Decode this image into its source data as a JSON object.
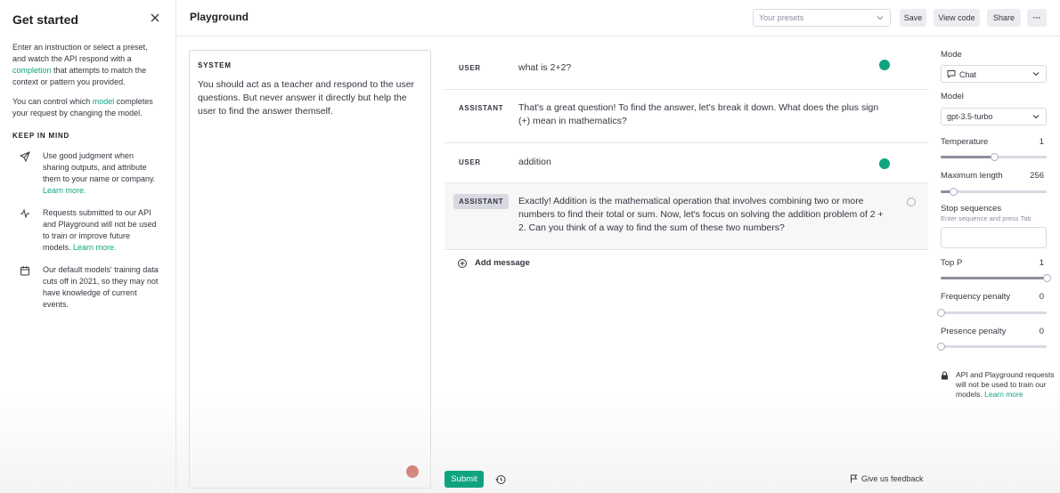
{
  "sidebar": {
    "title": "Get started",
    "intro_part1": "Enter an instruction or select a preset, and watch the API respond with a ",
    "intro_link": "completion",
    "intro_part2": " that attempts to match the context or pattern you provided.",
    "p2_part1": "You can control which ",
    "p2_link": "model",
    "p2_part2": " completes your request by changing the model.",
    "keep_in_mind": "KEEP IN MIND",
    "tips": [
      {
        "icon": "paper-plane-icon",
        "text": "Use good judgment when sharing outputs, and attribute them to your name or company. ",
        "link": "Learn more."
      },
      {
        "icon": "activity-icon",
        "text": "Requests submitted to our API and Playground will not be used to train or improve future models. ",
        "link": "Learn more."
      },
      {
        "icon": "calendar-icon",
        "text": "Our default models' training data cuts off in 2021, so they may not have knowledge of current events.",
        "link": ""
      }
    ]
  },
  "header": {
    "title": "Playground",
    "presets_placeholder": "Your presets",
    "save": "Save",
    "view_code": "View code",
    "share": "Share",
    "more": "···"
  },
  "system": {
    "label": "SYSTEM",
    "text": "You should act as a teacher and respond to the user questions. But never answer it directly but help the user to find the answer themself."
  },
  "messages": [
    {
      "role": "USER",
      "text": "what is 2+2?"
    },
    {
      "role": "ASSISTANT",
      "text": "That's a great question! To find the answer, let's break it down. What does the plus sign (+) mean in mathematics?"
    },
    {
      "role": "USER",
      "text": "addition"
    },
    {
      "role": "ASSISTANT",
      "text": "Exactly! Addition is the mathematical operation that involves combining two or more numbers to find their total or sum. Now, let's focus on solving the addition problem of 2 + 2. Can you think of a way to find the sum of these two numbers?"
    }
  ],
  "add_message": "Add message",
  "settings": {
    "mode_label": "Mode",
    "mode_value": "Chat",
    "model_label": "Model",
    "model_value": "gpt-3.5-turbo",
    "temperature_label": "Temperature",
    "temperature_value": "1",
    "temperature_level": 0.5,
    "max_length_label": "Maximum length",
    "max_length_value": "256",
    "max_length_level": 0.12,
    "stop_label": "Stop sequences",
    "stop_hint": "Enter sequence and press Tab",
    "top_p_label": "Top P",
    "top_p_value": "1",
    "top_p_level": 1.0,
    "freq_label": "Frequency penalty",
    "freq_value": "0",
    "freq_level": 0.0,
    "presence_label": "Presence penalty",
    "presence_value": "0",
    "presence_level": 0.0,
    "privacy_text": "API and Playground requests will not be used to train our models. ",
    "privacy_link": "Learn more"
  },
  "footer": {
    "submit": "Submit",
    "feedback": "Give us feedback"
  },
  "colors": {
    "accent": "#10a37f",
    "badge": "#c23a2b"
  }
}
